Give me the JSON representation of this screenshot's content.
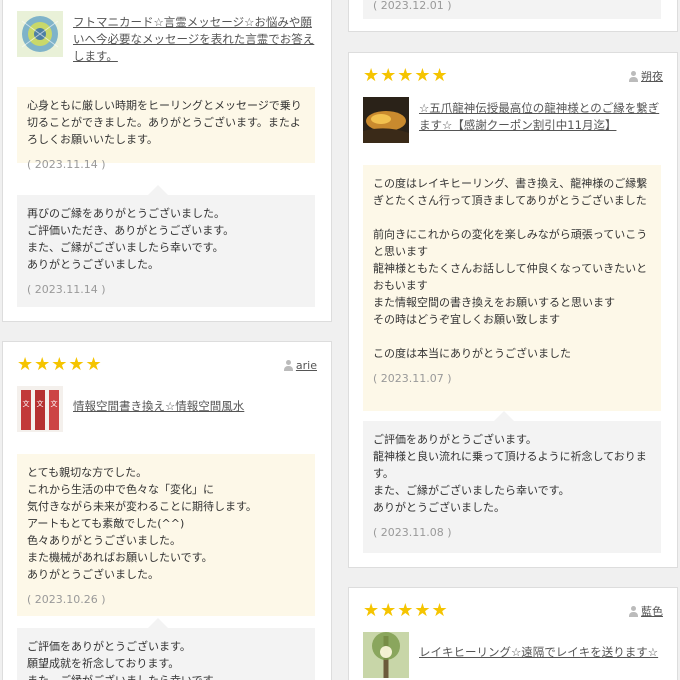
{
  "left": {
    "card1": {
      "product_title": "フトマニカード☆言霊メッセージ☆お悩みや願いへ今必要なメッセージを表れた言霊でお答えします。",
      "review_text": "心身ともに厳しい時期をヒーリングとメッセージで乗り切ることができました。ありがとうございます。またよろしくお願いいたします。",
      "review_date": "( 2023.11.14 )",
      "reply_text": "再びのご縁をありがとうございました。\nご評価いただき、ありがとうございます。\nまた、ご縁がございましたら幸いです。\nありがとうございました。",
      "reply_date": "( 2023.11.14 )"
    },
    "card2": {
      "stars": "★★★★★",
      "reviewer": "arie",
      "product_title": "情報空間書き換え☆情報空間風水",
      "review_text": "とても親切な方でした。\nこれから生活の中で色々な「変化」に\n気付きながら未来が変わることに期待します。\nアートもとても素敵でした(^^)\n色々ありがとうございました。\nまた機械があればお願いしたいです。\nありがとうございました。",
      "review_date": "( 2023.10.26 )",
      "reply_text": "ご評価をありがとうございます。\n願望成就を祈念しております。\nまた、ご縁がございましたら幸いです。"
    }
  },
  "right": {
    "card0": {
      "reply_date": "( 2023.12.01 )"
    },
    "card1": {
      "stars": "★★★★★",
      "reviewer": "朔夜",
      "product_title": "☆五爪龍神伝授最高位の龍神様とのご縁を繋ぎます☆【感謝クーポン割引中11月迄】",
      "review_text": "この度はレイキヒーリング、書き換え、龍神様のご縁繋ぎとたくさん行って頂きましてありがとうございました\n\n前向きにこれからの変化を楽しみながら頑張っていこうと思います\n龍神様ともたくさんお話しして仲良くなっていきたいとおもいます\nまた情報空間の書き換えをお願いすると思います\nその時はどうぞ宜しくお願い致します\n\nこの度は本当にありがとうございました",
      "review_date": "( 2023.11.07 )",
      "reply_text": "ご評価をありがとうございます。\n龍神様と良い流れに乗って頂けるように祈念しております。\nまた、ご縁がございましたら幸いです。\nありがとうございました。",
      "reply_date": "( 2023.11.08 )"
    },
    "card2": {
      "stars": "★★★★★",
      "reviewer": "藍色",
      "product_title": "レイキヒーリング☆遠隔でレイキを送ります☆"
    }
  }
}
